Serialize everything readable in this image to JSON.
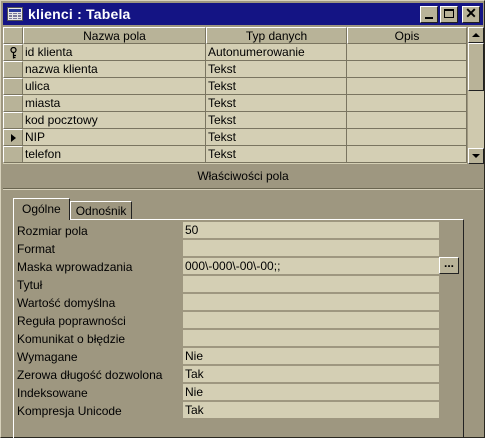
{
  "window": {
    "title": "klienci : Tabela"
  },
  "grid": {
    "headers": {
      "name": "Nazwa pola",
      "type": "Typ danych",
      "desc": "Opis"
    },
    "rows": [
      {
        "name": "id klienta",
        "type": "Autonumerowanie",
        "desc": "",
        "marker": "key"
      },
      {
        "name": "nazwa klienta",
        "type": "Tekst",
        "desc": "",
        "marker": ""
      },
      {
        "name": "ulica",
        "type": "Tekst",
        "desc": "",
        "marker": ""
      },
      {
        "name": "miasta",
        "type": "Tekst",
        "desc": "",
        "marker": ""
      },
      {
        "name": "kod pocztowy",
        "type": "Tekst",
        "desc": "",
        "marker": ""
      },
      {
        "name": "NIP",
        "type": "Tekst",
        "desc": "",
        "marker": "current"
      },
      {
        "name": "telefon",
        "type": "Tekst",
        "desc": "",
        "marker": ""
      }
    ]
  },
  "properties": {
    "title": "Właściwości pola",
    "tabs": {
      "general": "Ogólne",
      "lookup": "Odnośnik"
    },
    "dots_label": "...",
    "rows": [
      {
        "label": "Rozmiar pola",
        "value": "50"
      },
      {
        "label": "Format",
        "value": ""
      },
      {
        "label": "Maska wprowadzania",
        "value": "000\\-000\\-00\\-00;;"
      },
      {
        "label": "Tytuł",
        "value": ""
      },
      {
        "label": "Wartość domyślna",
        "value": ""
      },
      {
        "label": "Reguła poprawności",
        "value": ""
      },
      {
        "label": "Komunikat o błędzie",
        "value": ""
      },
      {
        "label": "Wymagane",
        "value": "Nie"
      },
      {
        "label": "Zerowa długość dozwolona",
        "value": "Tak"
      },
      {
        "label": "Indeksowane",
        "value": "Nie"
      },
      {
        "label": "Kompresja Unicode",
        "value": "Tak"
      }
    ]
  },
  "colors": {
    "titlebar": "#141484",
    "face": "#9e9780",
    "field": "#d4cfb4"
  }
}
